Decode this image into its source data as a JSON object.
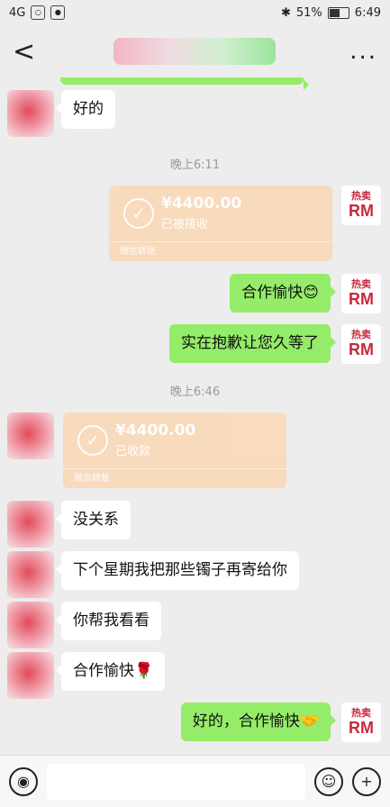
{
  "status_bar": {
    "signal": "4G",
    "battery": "51%",
    "time": "6:49"
  },
  "header": {
    "back": "<",
    "more": "..."
  },
  "messages": {
    "m1": "好的",
    "t1": "晚上6:11",
    "transfer1_amount": "¥4400.00",
    "transfer1_status": "已被接收",
    "transfer1_label": "微信转账",
    "m2": "合作愉快😊",
    "m3": "实在抱歉让您久等了",
    "t2": "晚上6:46",
    "transfer2_amount": "¥4400.00",
    "transfer2_status": "已收款",
    "transfer2_label": "微信转账",
    "m4": "没关系",
    "m5": "下个星期我把那些镯子再寄给你",
    "m6": "你帮我看看",
    "m7": "合作愉快🌹",
    "m8": "好的，合作愉快🤝"
  },
  "avatar_rm": {
    "cn": "热卖",
    "en": "RM"
  },
  "input": {
    "voice_icon": "voice-icon",
    "emoji_icon": "emoji-icon",
    "plus_icon": "plus-icon"
  },
  "colors": {
    "self_bubble": "#95ec69",
    "transfer": "#fad9b7",
    "background": "#ededed"
  }
}
